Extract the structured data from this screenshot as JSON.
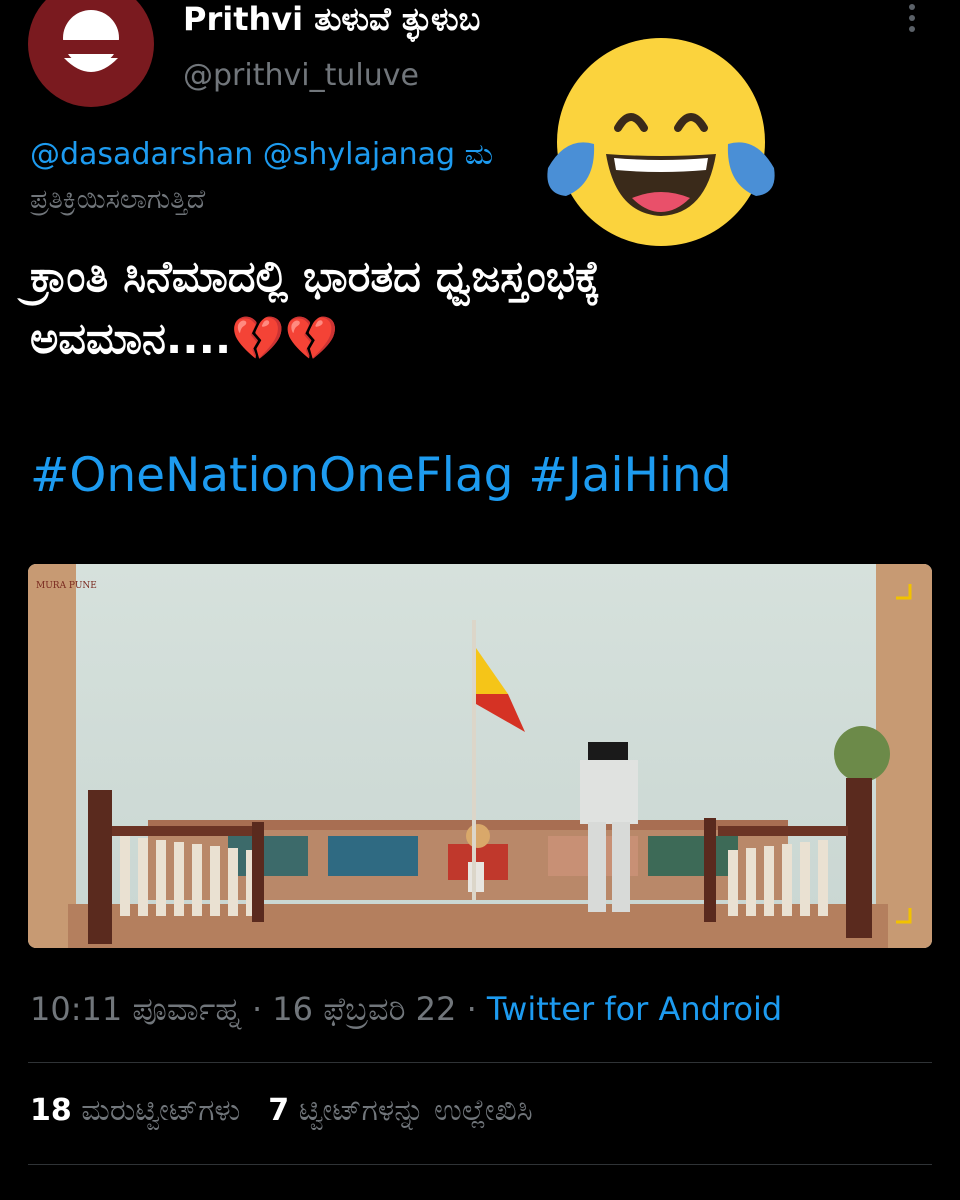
{
  "tweet": {
    "display_name": "Prithvi ತುಳುವೆ ತ್ಳುಳುಬ",
    "handle": "@prithvi_tuluve",
    "reply_to": {
      "mentions": "@dasadarshan @shylajanag",
      "truncated_tail": "ಮ",
      "suffix": "ಪ್ರತಿಕ್ರಿಯಿಸಲಾಗುತ್ತಿದೆ"
    },
    "text_line1": "ಕ್ರಾಂತಿ ಸಿನೆಮಾದಲ್ಲಿ ಭಾರತದ ಧ್ವಜಸ್ತಂಭಕ್ಕೆ",
    "text_line2": "ಅವಮಾನ....",
    "broken_heart_emoji": "💔💔",
    "hashtags": "#OneNationOneFlag #JaiHind",
    "meta": {
      "time": "10:11 ಪೂರ್ವಾಹ್ನ",
      "separator": "·",
      "date": "16 ಫೆಬ್ರವರಿ 22",
      "client": "Twitter for Android"
    },
    "stats": {
      "retweets_count": "18",
      "retweets_label": "ಮರುಟ್ವೀಟ್‌ಗಳು",
      "quotes_count": "7",
      "quotes_label": "ಟ್ವೀಟ್‌ಗಳನ್ನು ಉಲ್ಲೇಖಿಸಿ"
    }
  },
  "media": {
    "description_icon": "movie-still-flag-scene",
    "watermark": "MURA PUNE"
  },
  "overlay": {
    "emoji_icon": "tears-of-joy-emoji-icon"
  },
  "colors": {
    "background": "#000000",
    "link": "#1d9bf0",
    "secondary_text": "#71767b",
    "avatar": "#7a1a1f"
  }
}
